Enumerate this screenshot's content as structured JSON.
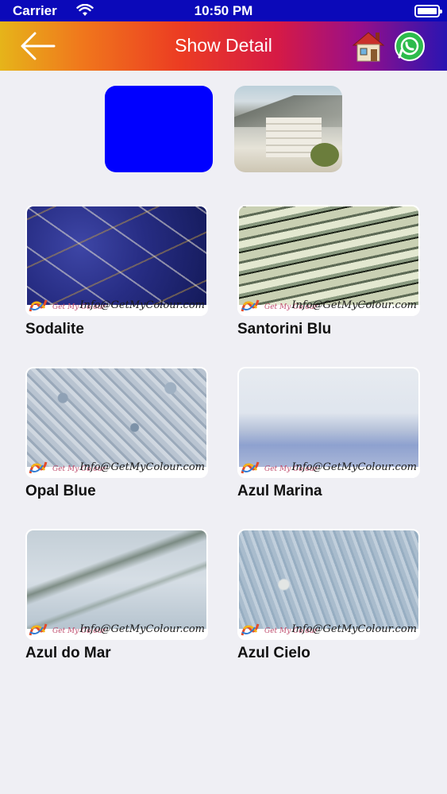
{
  "status_bar": {
    "carrier": "Carrier",
    "time": "10:50 PM"
  },
  "header": {
    "title": "Show Detail",
    "back_icon": "back-arrow-icon",
    "home_icon": "home-icon",
    "whatsapp_icon": "whatsapp-icon"
  },
  "top": {
    "color_swatch": "#0000ff"
  },
  "watermark": {
    "brand": "Get My Colour",
    "email": "Info@GetMyColour.com"
  },
  "products": [
    {
      "name": "Sodalite"
    },
    {
      "name": "Santorini Blu"
    },
    {
      "name": "Opal Blue"
    },
    {
      "name": "Azul Marina"
    },
    {
      "name": "Azul do Mar"
    },
    {
      "name": "Azul Cielo"
    }
  ]
}
